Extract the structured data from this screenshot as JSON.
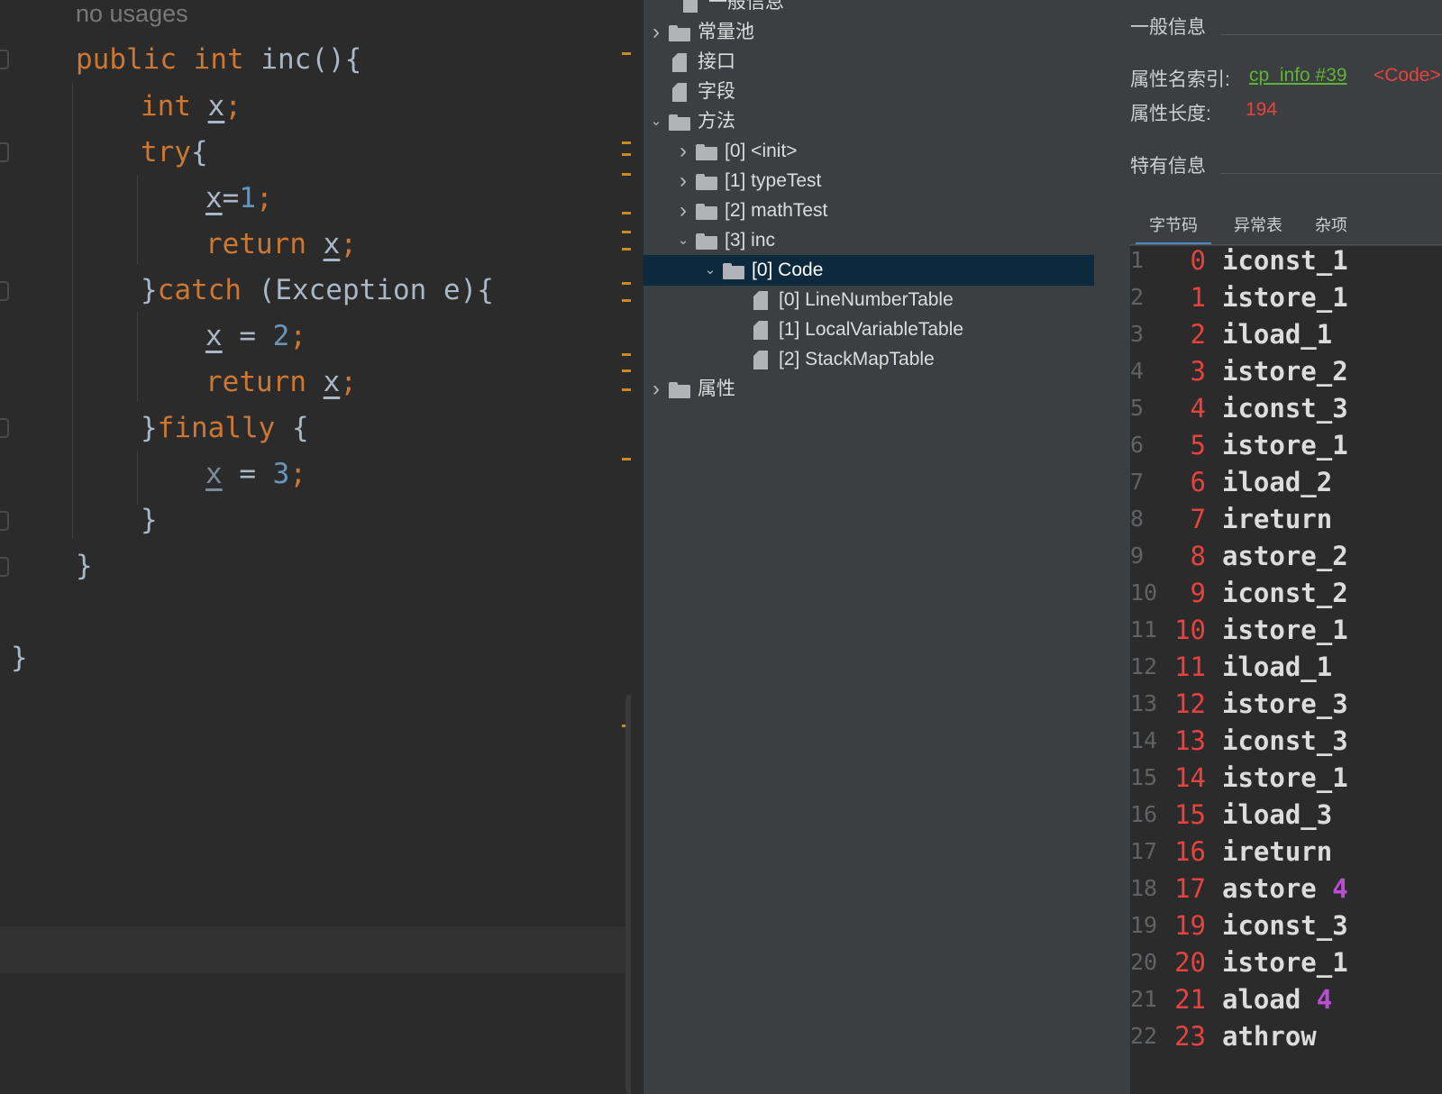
{
  "editor": {
    "usage_hint": "no usages",
    "lines": [
      [
        {
          "t": "public ",
          "c": "kw"
        },
        {
          "t": "int ",
          "c": "kw"
        },
        {
          "t": "inc",
          "c": "fn"
        },
        {
          "t": "(){",
          "c": ""
        }
      ],
      [
        {
          "t": "int ",
          "c": "kw"
        },
        {
          "t": "x",
          "c": "var"
        },
        {
          "t": ";",
          "c": "kw"
        }
      ],
      [
        {
          "t": "try",
          "c": "kw"
        },
        {
          "t": "{",
          "c": ""
        }
      ],
      [
        {
          "t": "x",
          "c": "var"
        },
        {
          "t": "=",
          "c": ""
        },
        {
          "t": "1",
          "c": "num"
        },
        {
          "t": ";",
          "c": "kw"
        }
      ],
      [
        {
          "t": "return ",
          "c": "kw"
        },
        {
          "t": "x",
          "c": "var"
        },
        {
          "t": ";",
          "c": "kw"
        }
      ],
      [
        {
          "t": "}",
          "c": ""
        },
        {
          "t": "catch ",
          "c": "kw"
        },
        {
          "t": "(Exception e){",
          "c": ""
        }
      ],
      [
        {
          "t": "x",
          "c": "var"
        },
        {
          "t": " = ",
          "c": ""
        },
        {
          "t": "2",
          "c": "num"
        },
        {
          "t": ";",
          "c": "kw"
        }
      ],
      [
        {
          "t": "return ",
          "c": "kw"
        },
        {
          "t": "x",
          "c": "var"
        },
        {
          "t": ";",
          "c": "kw"
        }
      ],
      [
        {
          "t": "}",
          "c": ""
        },
        {
          "t": "finally ",
          "c": "kw"
        },
        {
          "t": "{",
          "c": ""
        }
      ],
      [
        {
          "t": "x",
          "c": "var dim"
        },
        {
          "t": " = ",
          "c": ""
        },
        {
          "t": "3",
          "c": "num"
        },
        {
          "t": ";",
          "c": "kw"
        }
      ],
      [
        {
          "t": "}",
          "c": ""
        }
      ],
      [
        {
          "t": "}",
          "c": ""
        }
      ],
      [
        {
          "t": "}",
          "c": ""
        }
      ]
    ]
  },
  "tree": {
    "top_item": "一般信息",
    "items": [
      {
        "label": "常量池",
        "type": "folder",
        "state": "collapsed"
      },
      {
        "label": "接口",
        "type": "file",
        "state": ""
      },
      {
        "label": "字段",
        "type": "file",
        "state": ""
      },
      {
        "label": "方法",
        "type": "folder",
        "state": "expanded"
      },
      {
        "label": "[0] <init>",
        "type": "folder",
        "state": "collapsed"
      },
      {
        "label": "[1] typeTest",
        "type": "folder",
        "state": "collapsed"
      },
      {
        "label": "[2] mathTest",
        "type": "folder",
        "state": "collapsed"
      },
      {
        "label": "[3] inc",
        "type": "folder",
        "state": "expanded"
      },
      {
        "label": "[0] Code",
        "type": "folder",
        "state": "expanded"
      },
      {
        "label": "[0] LineNumberTable",
        "type": "file",
        "state": ""
      },
      {
        "label": "[1] LocalVariableTable",
        "type": "file",
        "state": ""
      },
      {
        "label": "[2] StackMapTable",
        "type": "file",
        "state": ""
      },
      {
        "label": "属性",
        "type": "folder",
        "state": "collapsed"
      }
    ]
  },
  "info": {
    "general_title": "一般信息",
    "name_index_label": "属性名索引:",
    "name_index_link": "cp_info #39",
    "name_index_value": "<Code>",
    "length_label": "属性长度:",
    "length_value": "194",
    "specific_title": "特有信息",
    "tabs": [
      "字节码",
      "异常表",
      "杂项"
    ],
    "active_tab": "字节码"
  },
  "bytecode": [
    {
      "ln": "1",
      "off": "0",
      "op": "iconst_1",
      "arg": ""
    },
    {
      "ln": "2",
      "off": "1",
      "op": "istore_1",
      "arg": ""
    },
    {
      "ln": "3",
      "off": "2",
      "op": "iload_1",
      "arg": ""
    },
    {
      "ln": "4",
      "off": "3",
      "op": "istore_2",
      "arg": ""
    },
    {
      "ln": "5",
      "off": "4",
      "op": "iconst_3",
      "arg": ""
    },
    {
      "ln": "6",
      "off": "5",
      "op": "istore_1",
      "arg": ""
    },
    {
      "ln": "7",
      "off": "6",
      "op": "iload_2",
      "arg": ""
    },
    {
      "ln": "8",
      "off": "7",
      "op": "ireturn",
      "arg": ""
    },
    {
      "ln": "9",
      "off": "8",
      "op": "astore_2",
      "arg": ""
    },
    {
      "ln": "10",
      "off": "9",
      "op": "iconst_2",
      "arg": ""
    },
    {
      "ln": "11",
      "off": "10",
      "op": "istore_1",
      "arg": ""
    },
    {
      "ln": "12",
      "off": "11",
      "op": "iload_1",
      "arg": ""
    },
    {
      "ln": "13",
      "off": "12",
      "op": "istore_3",
      "arg": ""
    },
    {
      "ln": "14",
      "off": "13",
      "op": "iconst_3",
      "arg": ""
    },
    {
      "ln": "15",
      "off": "14",
      "op": "istore_1",
      "arg": ""
    },
    {
      "ln": "16",
      "off": "15",
      "op": "iload_3",
      "arg": ""
    },
    {
      "ln": "17",
      "off": "16",
      "op": "ireturn",
      "arg": ""
    },
    {
      "ln": "18",
      "off": "17",
      "op": "astore",
      "arg": "4"
    },
    {
      "ln": "19",
      "off": "19",
      "op": "iconst_3",
      "arg": ""
    },
    {
      "ln": "20",
      "off": "20",
      "op": "istore_1",
      "arg": ""
    },
    {
      "ln": "21",
      "off": "21",
      "op": "aload",
      "arg": "4"
    },
    {
      "ln": "22",
      "off": "23",
      "op": "athrow",
      "arg": ""
    }
  ],
  "colors": {
    "editor_bg": "#2b2b2b",
    "keyword": "#cc7832",
    "number": "#6897bb",
    "panel_bg": "#3c3f41",
    "selection": "#0d293e",
    "offset_red": "#e8423f",
    "link_green": "#5fb236",
    "arg_purple": "#b94ed1"
  }
}
